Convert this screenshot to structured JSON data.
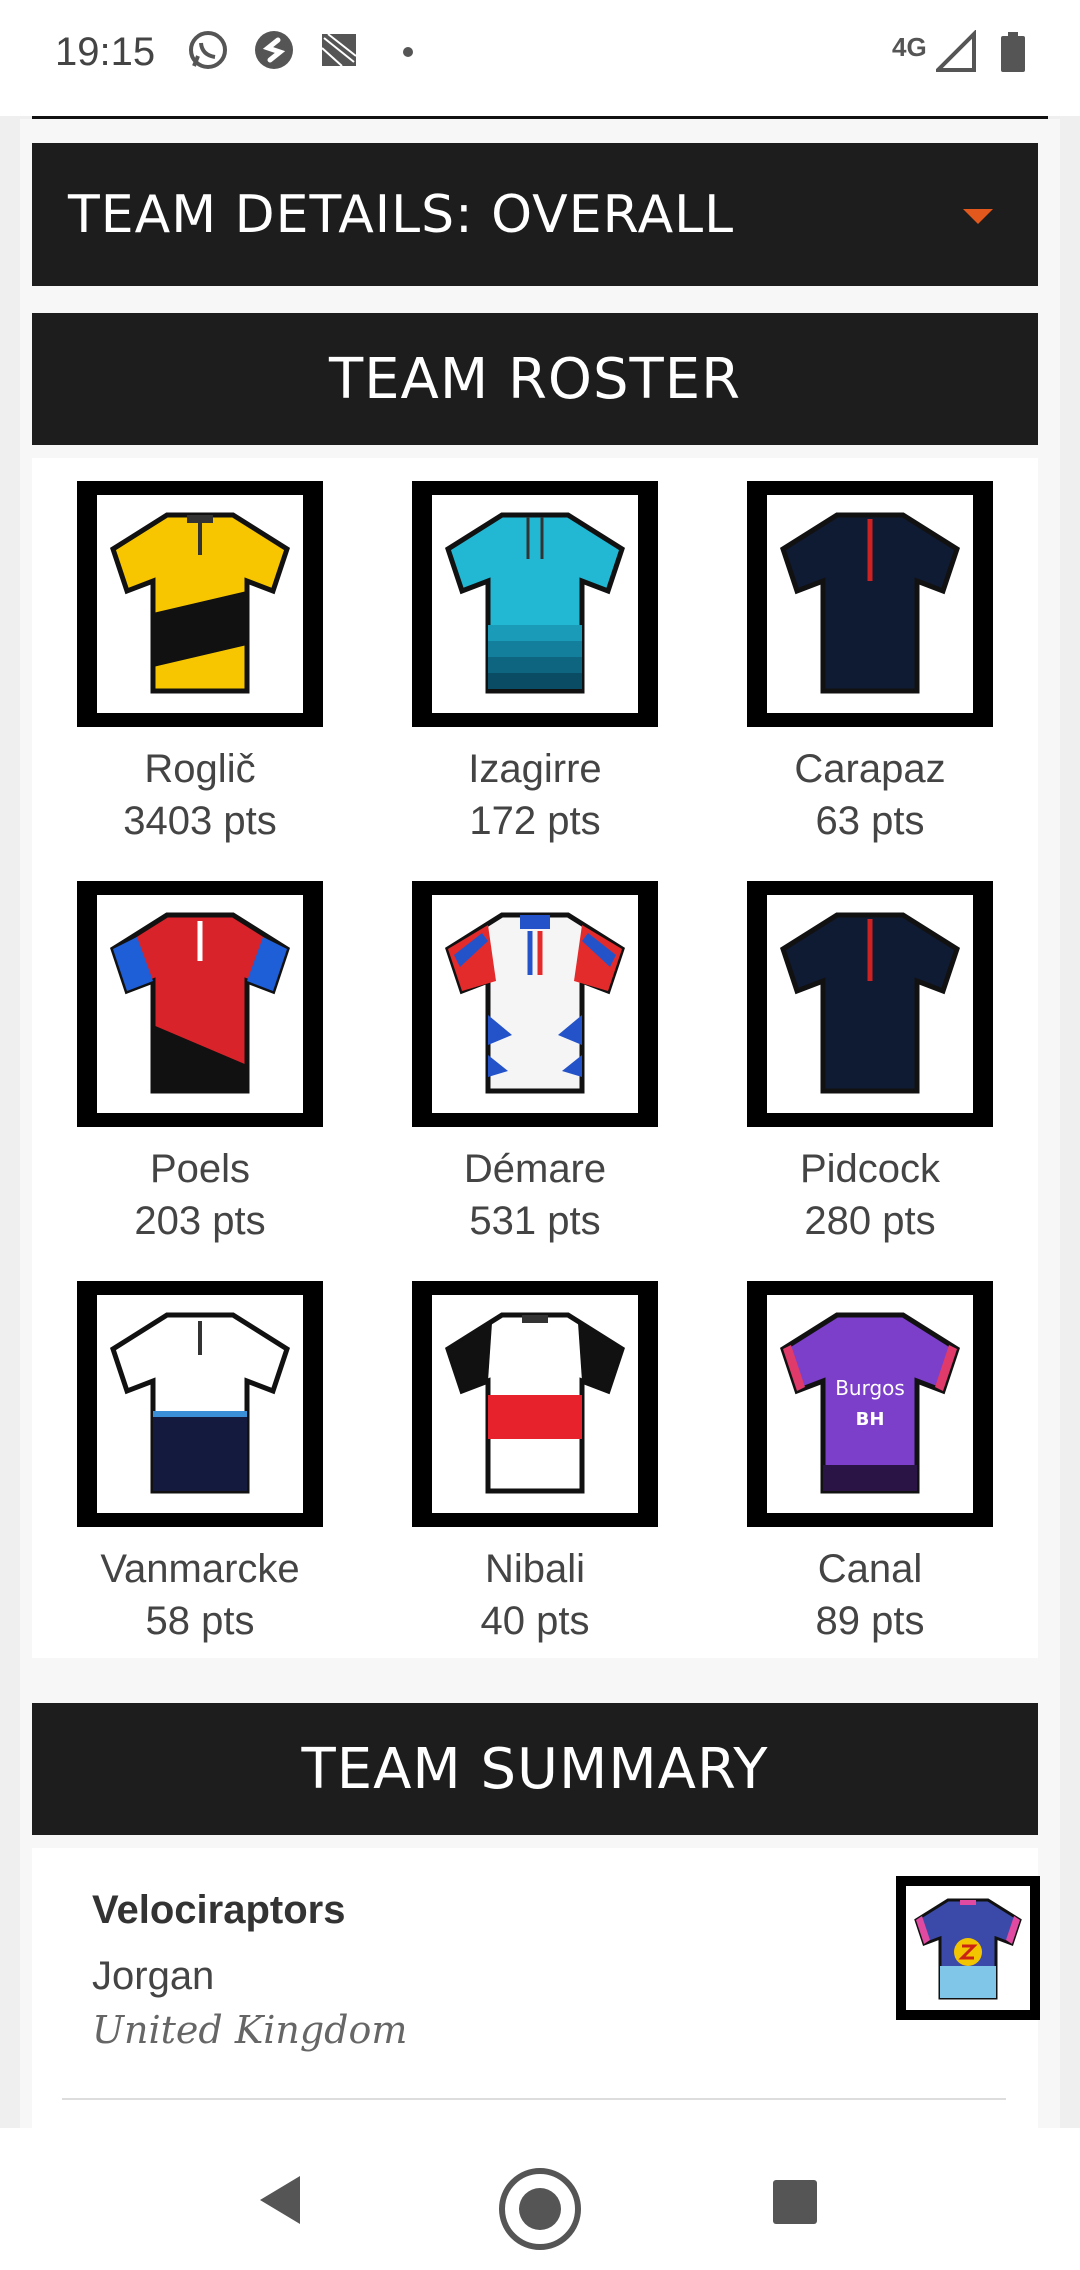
{
  "status_bar": {
    "time": "19:15",
    "network": "4G",
    "icons": [
      "whatsapp-icon",
      "shazam-icon",
      "gallery-icon",
      "dot-icon",
      "signal-icon",
      "battery-icon"
    ]
  },
  "details_bar": {
    "label": "TEAM DETAILS: OVERALL",
    "accent": "#e3591d"
  },
  "roster": {
    "title": "TEAM ROSTER",
    "riders": [
      {
        "name": "Roglič",
        "points": "3403 pts",
        "jersey": "jumbo-visma"
      },
      {
        "name": "Izagirre",
        "points": "172 pts",
        "jersey": "astana"
      },
      {
        "name": "Carapaz",
        "points": "63 pts",
        "jersey": "ineos"
      },
      {
        "name": "Poels",
        "points": "203 pts",
        "jersey": "bahrain"
      },
      {
        "name": "Démare",
        "points": "531 pts",
        "jersey": "groupama"
      },
      {
        "name": "Pidcock",
        "points": "280 pts",
        "jersey": "ineos"
      },
      {
        "name": "Vanmarcke",
        "points": "58 pts",
        "jersey": "israel"
      },
      {
        "name": "Nibali",
        "points": "40 pts",
        "jersey": "trek"
      },
      {
        "name": "Canal",
        "points": "89 pts",
        "jersey": "burgos"
      }
    ]
  },
  "summary": {
    "title": "TEAM SUMMARY",
    "team_name": "Velociraptors",
    "owner": "Jorgan",
    "country": "United Kingdom"
  },
  "colors": {
    "bar_bg": "#1d1d1d",
    "page_bg": "#efefef"
  }
}
